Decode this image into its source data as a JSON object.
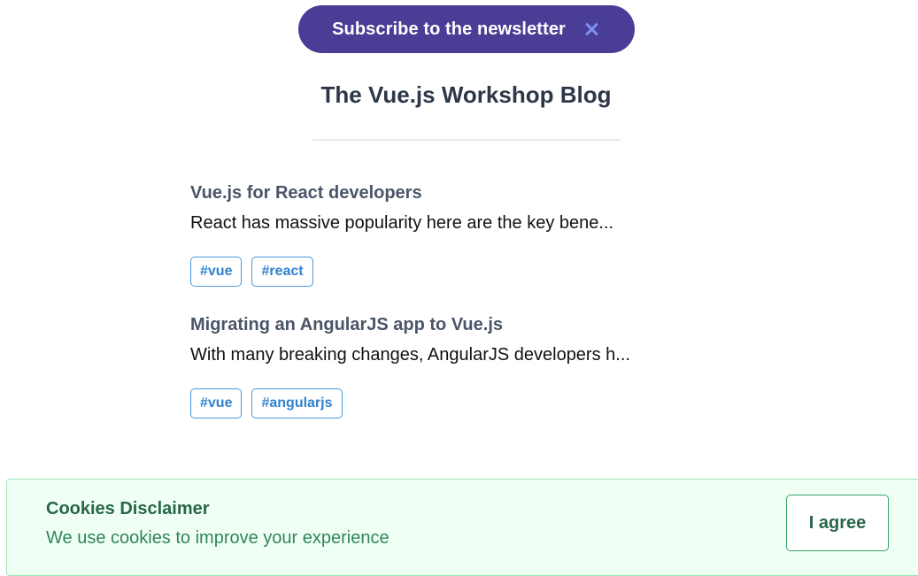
{
  "newsletter": {
    "label": "Subscribe to the newsletter",
    "close_icon": "close-icon",
    "background": "#4a3d96"
  },
  "blog": {
    "title": "The Vue.js Workshop Blog"
  },
  "posts": [
    {
      "title": "Vue.js for React developers",
      "excerpt": "React has massive popularity here are the key bene...",
      "tags": [
        "#vue",
        "#react"
      ]
    },
    {
      "title": "Migrating an AngularJS app to Vue.js",
      "excerpt": "With many breaking changes, AngularJS developers h...",
      "tags": [
        "#vue",
        "#angularjs"
      ]
    }
  ],
  "cookies": {
    "title": "Cookies Disclaimer",
    "text": "We use cookies to improve your experience",
    "agree_label": "I agree",
    "accent": "#276749"
  }
}
